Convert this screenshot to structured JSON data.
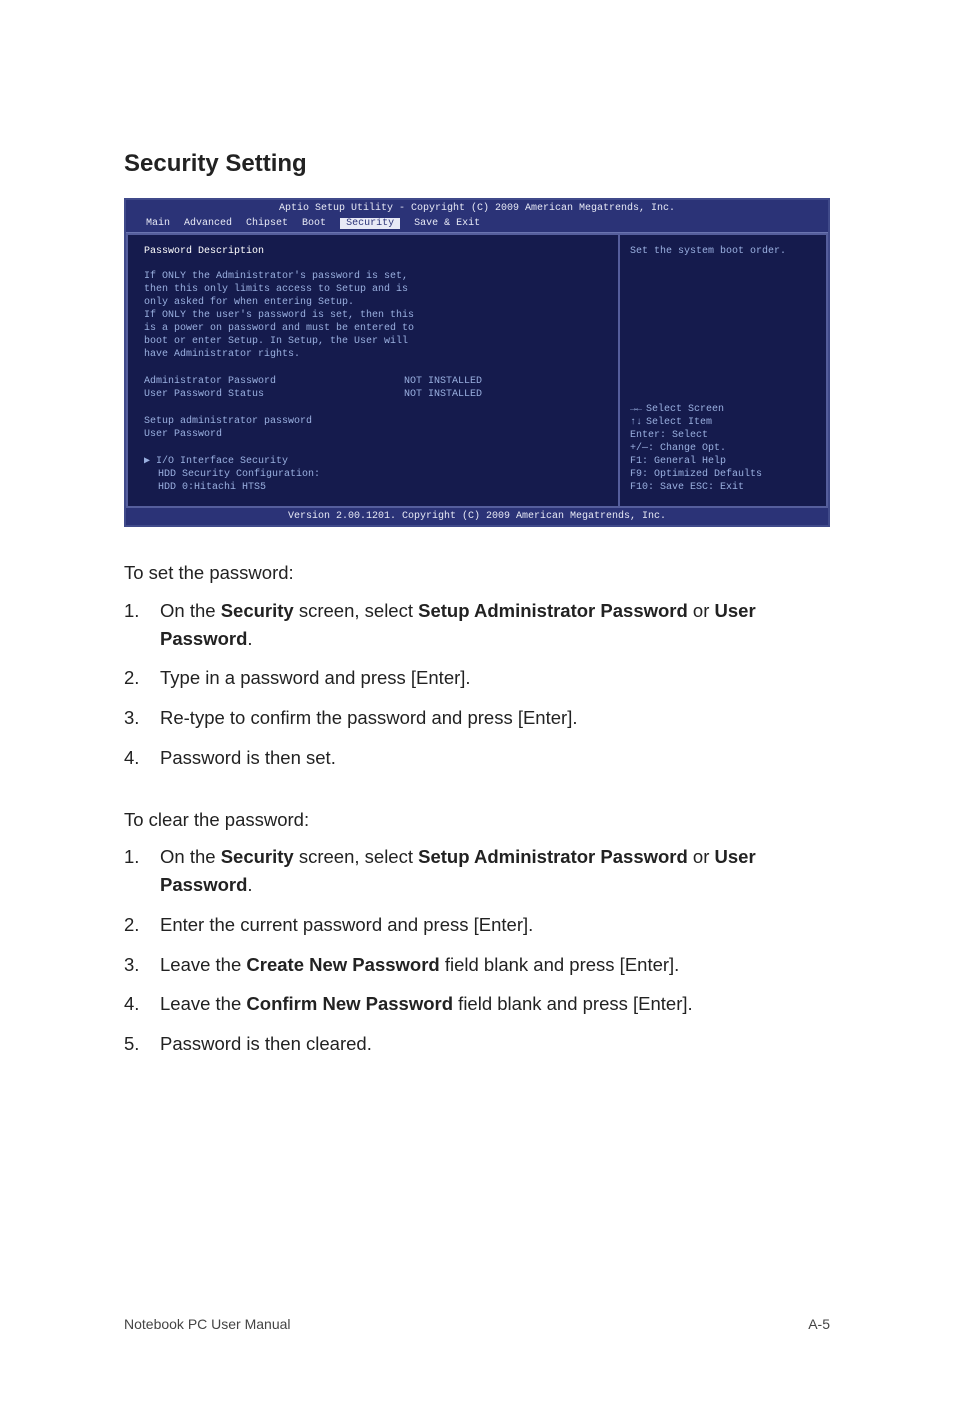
{
  "title": "Security Setting",
  "bios": {
    "topbar": "Aptio Setup Utility - Copyright (C) 2009 American Megatrends, Inc.",
    "tabs": [
      "Main",
      "Advanced",
      "Chipset",
      "Boot",
      "Security",
      "Save & Exit"
    ],
    "active_tab_index": 4,
    "left": {
      "header": "Password Description",
      "description": [
        "If ONLY the Administrator's password is set,",
        "then this only limits access to Setup and is",
        "only asked for when entering Setup.",
        "If ONLY the user's password is set, then this",
        "is a power on password and must be entered to",
        "boot or enter Setup. In Setup, the User will",
        "have Administrator rights."
      ],
      "rows": [
        {
          "label": "Administrator Password",
          "value": "NOT INSTALLED"
        },
        {
          "label": "User Password Status",
          "value": "NOT INSTALLED"
        }
      ],
      "actions": [
        "Setup administrator password",
        "User Password"
      ],
      "submenu": {
        "prefix": "▶",
        "label": "I/O Interface Security"
      },
      "extra": [
        "HDD Security Configuration:",
        "HDD 0:Hitachi HTS5"
      ]
    },
    "right": {
      "help_header": "Set the system boot order.",
      "nav": [
        {
          "k": "arrows",
          "text": "Select Screen"
        },
        {
          "k": "updown",
          "text": "Select Item"
        },
        {
          "k": "enter",
          "text": "Enter: Select"
        },
        {
          "k": "pm",
          "text": "+/—:  Change Opt."
        },
        {
          "k": "f1",
          "text": "F1:    General Help"
        },
        {
          "k": "f9",
          "text": "F9:    Optimized Defaults"
        },
        {
          "k": "f10",
          "text": "F10:  Save   ESC:  Exit"
        }
      ]
    },
    "footer": "Version 2.00.1201. Copyright (C) 2009 American Megatrends, Inc."
  },
  "set_password": {
    "lead": "To set the password:",
    "steps": [
      {
        "n": "1.",
        "html": "On the <b>Security</b> screen, select <b>Setup Administrator Password</b> or <b>User Password</b>."
      },
      {
        "n": "2.",
        "html": "Type in a password and press [Enter]."
      },
      {
        "n": "3.",
        "html": "Re-type to confirm the password and press [Enter]."
      },
      {
        "n": "4.",
        "html": "Password is then set."
      }
    ]
  },
  "clear_password": {
    "lead": "To clear the password:",
    "steps": [
      {
        "n": "1.",
        "html": "On the <b>Security</b> screen, select <b>Setup Administrator Password</b> or <b>User Password</b>."
      },
      {
        "n": "2.",
        "html": "Enter the current password and press [Enter]."
      },
      {
        "n": "3.",
        "html": "Leave the <b>Create New Password</b> field blank and press [Enter]."
      },
      {
        "n": "4.",
        "html": "Leave the <b>Confirm New Password</b> field blank and press [Enter]."
      },
      {
        "n": "5.",
        "html": "Password is then cleared."
      }
    ]
  },
  "footer": {
    "left": "Notebook PC User Manual",
    "right": "A-5"
  }
}
